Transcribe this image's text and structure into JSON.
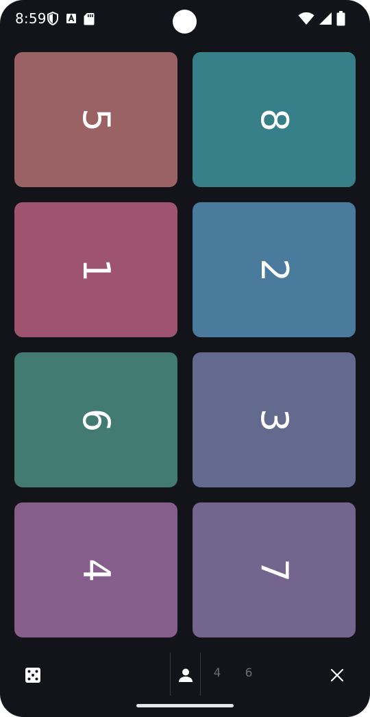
{
  "status_bar": {
    "time": "8:59",
    "left_icons": [
      "shield-icon",
      "font-a-icon",
      "sd-card-icon"
    ],
    "right_icons": [
      "wifi-icon",
      "signal-icon",
      "battery-icon"
    ]
  },
  "tiles": [
    {
      "number": "5",
      "color": "#9A6264"
    },
    {
      "number": "8",
      "color": "#37808A"
    },
    {
      "number": "1",
      "color": "#9E546E"
    },
    {
      "number": "2",
      "color": "#4A7A9C"
    },
    {
      "number": "6",
      "color": "#437A72"
    },
    {
      "number": "3",
      "color": "#636A8E"
    },
    {
      "number": "4",
      "color": "#865E8C"
    },
    {
      "number": "7",
      "color": "#74658F"
    }
  ],
  "bottom_bar": {
    "dice_icon": "dice-five-icon",
    "player_icon": "person-icon",
    "count_options": [
      "4",
      "6"
    ],
    "close_icon": "close-icon"
  },
  "colors": {
    "background": "#131419",
    "icon": "#FFFFFF",
    "muted_text": "#6A6C74"
  }
}
